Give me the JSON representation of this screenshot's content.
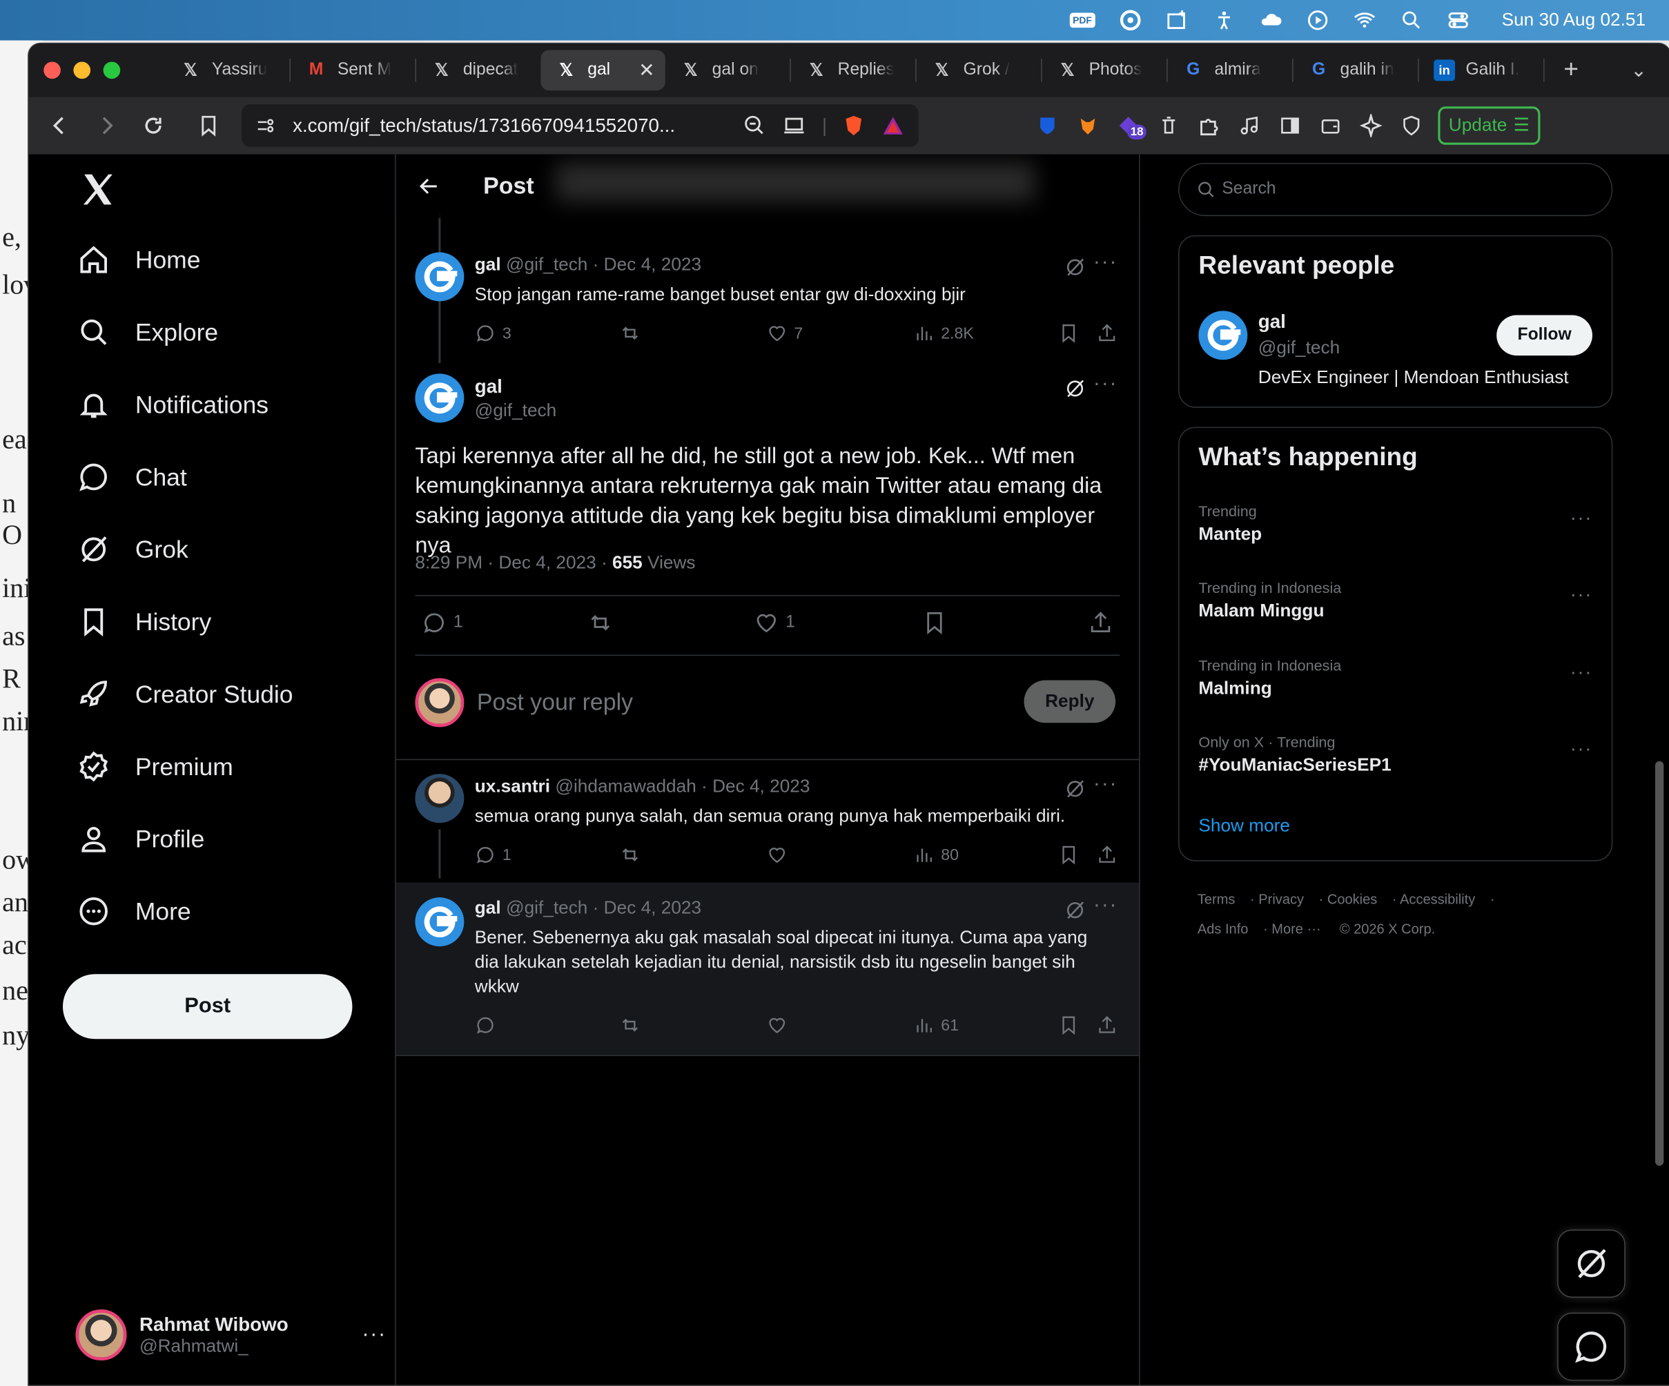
{
  "menubar": {
    "clock": "Sun 30 Aug  02.51",
    "pdf_label": "PDF"
  },
  "tabs": [
    {
      "label": "Yassiru",
      "icon": "x-icon"
    },
    {
      "label": "Sent M",
      "icon": "gmail-icon"
    },
    {
      "label": "dipecat",
      "icon": "x-icon"
    },
    {
      "label": "gal",
      "icon": "x-icon",
      "active": true
    },
    {
      "label": "gal on",
      "icon": "x-icon"
    },
    {
      "label": "Replies",
      "icon": "x-icon"
    },
    {
      "label": "Grok /",
      "icon": "x-icon"
    },
    {
      "label": "Photos",
      "icon": "x-icon"
    },
    {
      "label": "almira",
      "icon": "google-icon"
    },
    {
      "label": "galih in",
      "icon": "google-icon"
    },
    {
      "label": "Galih I.",
      "icon": "linkedin-icon"
    }
  ],
  "toolbar": {
    "url": "x.com/gif_tech/status/17316670941552070...",
    "update_label": "Update",
    "ext_badge": "18"
  },
  "nav": {
    "items": [
      "Home",
      "Explore",
      "Notifications",
      "Chat",
      "Grok",
      "History",
      "Creator Studio",
      "Premium",
      "Profile",
      "More"
    ],
    "post_label": "Post"
  },
  "account": {
    "name": "Rahmat Wibowo",
    "handle": "@Rahmatwi_",
    "more": "···"
  },
  "main": {
    "title": "Post",
    "tweet1": {
      "name": "gal",
      "meta": "@gif_tech · Dec 4, 2023",
      "text": "Stop jangan rame-rame banget buset entar gw di-doxxing bjir",
      "replies": "3",
      "likes": "7",
      "views": "2.8K"
    },
    "focus": {
      "name": "gal",
      "handle": "@gif_tech",
      "text": "Tapi kerennya after all he did, he still got a new job. Kek... Wtf men kemungkinannya antara rekruternya gak main Twitter atau emang dia saking jagonya attitude dia yang kek begitu bisa dimaklumi employer nya",
      "time": "8:29 PM · Dec 4, 2023 · ",
      "views_count": "655",
      "views_label": " Views",
      "replies": "1",
      "likes": "1"
    },
    "reply_box": {
      "placeholder": "Post your reply",
      "button": "Reply"
    },
    "tweet2": {
      "name": "ux.santri",
      "meta": "@ihdamawaddah · Dec 4, 2023",
      "text": "semua orang punya salah, dan semua orang punya hak memperbaiki diri.",
      "replies": "1",
      "views": "80"
    },
    "tweet3": {
      "name": "gal",
      "meta": "@gif_tech · Dec 4, 2023",
      "text": "Bener. Sebenernya aku gak masalah soal dipecat ini itunya. Cuma apa yang dia lakukan setelah kejadian itu denial, narsistik dsb itu ngeselin banget sih wkkw",
      "views": "61"
    }
  },
  "right": {
    "search_placeholder": "Search",
    "relevant": {
      "title": "Relevant people",
      "name": "gal",
      "handle": "@gif_tech",
      "bio": "DevEx Engineer | Mendoan Enthusiast",
      "follow": "Follow"
    },
    "happening": {
      "title": "What’s happening",
      "trends": [
        {
          "context": "Trending",
          "name": "Mantep"
        },
        {
          "context": "Trending in Indonesia",
          "name": "Malam Minggu"
        },
        {
          "context": "Trending in Indonesia",
          "name": "Malming"
        },
        {
          "context": "Only on X · Trending",
          "name": "#YouManiacSeriesEP1"
        }
      ],
      "show_more": "Show more"
    },
    "footer": [
      "Terms",
      "Privacy",
      "Cookies",
      "Accessibility",
      "Ads Info",
      "More ···",
      "© 2026 X Corp."
    ]
  },
  "colors": {
    "accent": "#1d9bf0",
    "background": "#000000",
    "update": "#3fb950"
  }
}
